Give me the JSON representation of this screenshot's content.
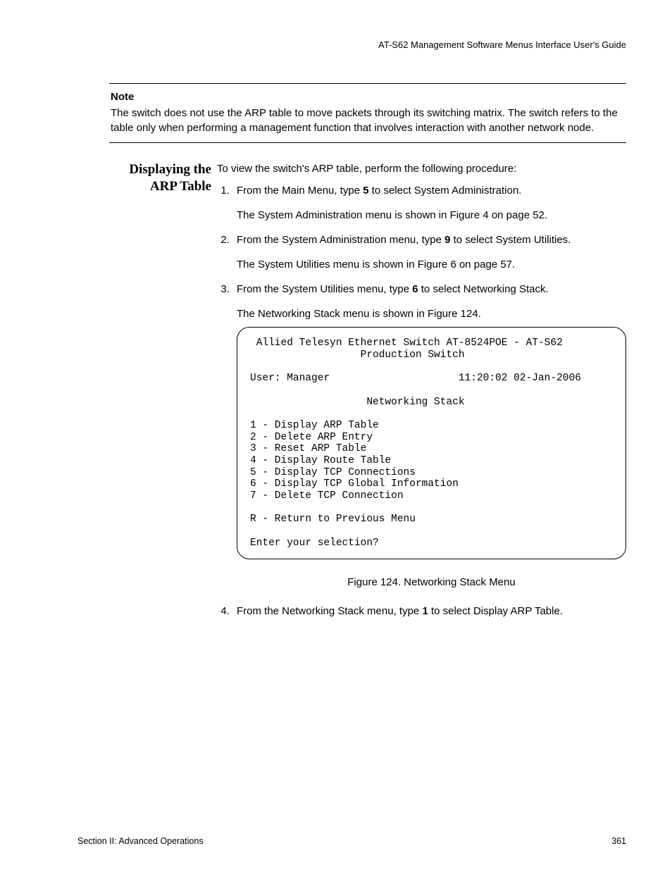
{
  "header": {
    "right": "AT-S62 Management Software Menus Interface User's Guide"
  },
  "note": {
    "label": "Note",
    "text": "The switch does not use the ARP table to move packets through its switching matrix. The switch refers to the table only when performing a management function that involves interaction with another network node."
  },
  "section": {
    "title_line1": "Displaying the",
    "title_line2": "ARP Table",
    "intro": "To view the switch's ARP table, perform the following procedure:",
    "steps": [
      {
        "text_pre": "From the Main Menu, type ",
        "bold": "5",
        "text_post": " to select System Administration.",
        "sub": "The System Administration menu is shown in Figure 4 on page 52."
      },
      {
        "text_pre": "From the System Administration menu, type ",
        "bold": "9",
        "text_post": " to select System Utilities.",
        "sub": "The System Utilities menu is shown in Figure 6 on page 57."
      },
      {
        "text_pre": "From the System Utilities menu, type ",
        "bold": "6",
        "text_post": " to select Networking Stack.",
        "sub": "The Networking Stack menu is shown in Figure 124."
      }
    ],
    "step4": {
      "text_pre": "From the Networking Stack menu, type ",
      "bold": "1",
      "text_post": " to select Display ARP Table."
    }
  },
  "menu": {
    "line1": " Allied Telesyn Ethernet Switch AT-8524POE - AT-S62",
    "line2": "                  Production Switch",
    "line3": "",
    "line4": "User: Manager                     11:20:02 02-Jan-2006",
    "line5": "",
    "line6": "                   Networking Stack",
    "line7": "",
    "line8": "1 - Display ARP Table",
    "line9": "2 - Delete ARP Entry",
    "line10": "3 - Reset ARP Table",
    "line11": "4 - Display Route Table",
    "line12": "5 - Display TCP Connections",
    "line13": "6 - Display TCP Global Information",
    "line14": "7 - Delete TCP Connection",
    "line15": "",
    "line16": "R - Return to Previous Menu",
    "line17": "",
    "line18": "Enter your selection?"
  },
  "figure_caption": "Figure 124. Networking Stack Menu",
  "footer": {
    "left": "Section II: Advanced Operations",
    "right": "361"
  }
}
